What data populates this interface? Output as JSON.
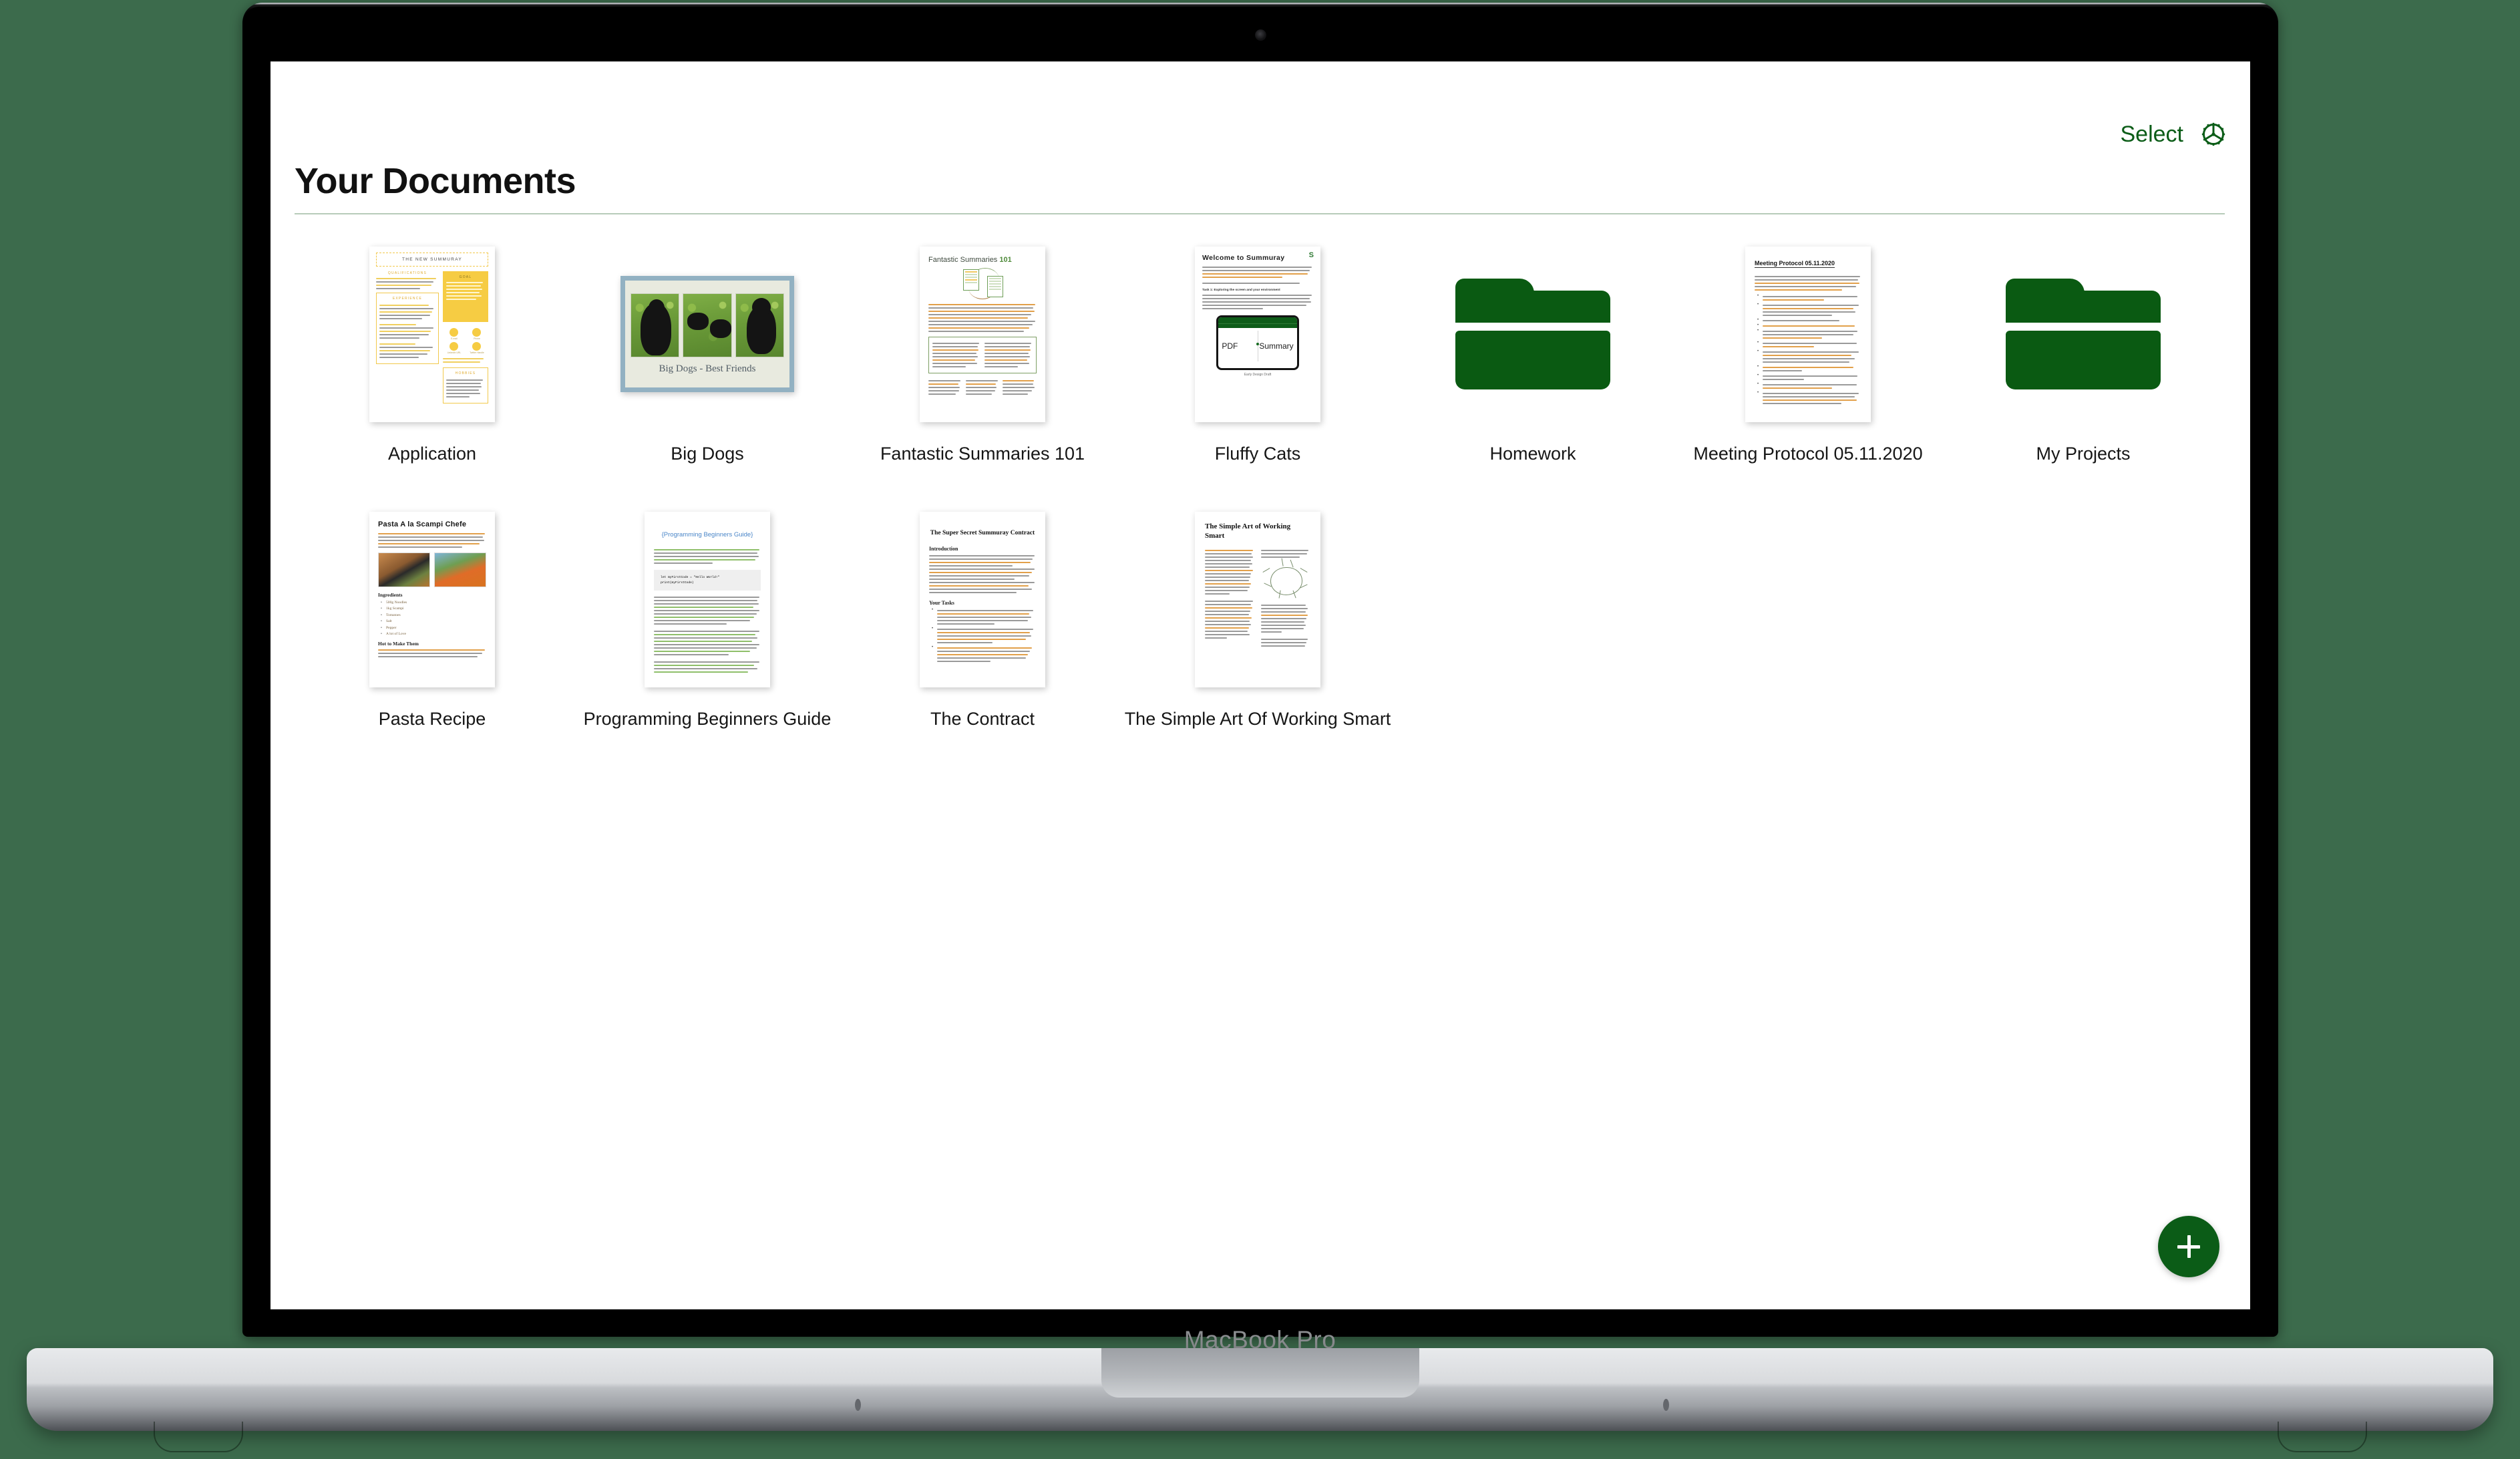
{
  "device": {
    "model_label": "MacBook Pro",
    "camera_icon": "camera-dot"
  },
  "app": {
    "title": "Your Documents",
    "accent_color": "#0b5c17",
    "header": {
      "select_label": "Select",
      "settings_icon": "gear-icon"
    },
    "fab": {
      "icon": "plus-icon",
      "color": "#0b5c17"
    }
  },
  "grid": {
    "items": [
      {
        "label": "Application",
        "type": "document",
        "thumbnail": {
          "kind": "cv",
          "title": "THE NEW SUMMURAY",
          "sections": [
            "QUALIFICATIONS",
            "EXPERIENCE",
            "GOAL",
            "HOBBIES"
          ],
          "accent": "#f6cc43",
          "contacts": [
            "E-mail",
            "Phone",
            "LinkedIn URL",
            "Twitter Handle"
          ]
        }
      },
      {
        "label": "Big Dogs",
        "type": "document",
        "selected": true,
        "thumbnail": {
          "kind": "photo-collage",
          "caption": "Big Dogs - Best Friends",
          "photo_count": 3,
          "selection_color": "#92b1c2",
          "page_color": "#e8eadf"
        }
      },
      {
        "label": "Fantastic Summaries 101",
        "type": "document",
        "thumbnail": {
          "kind": "article",
          "title_plain": "Fantastic Summaries ",
          "title_accent": "101",
          "accent": "#4f8a3a"
        }
      },
      {
        "label": "Fluffy Cats",
        "type": "document",
        "thumbnail": {
          "kind": "welcome",
          "title": "Welcome to Summuray",
          "task_heading": "Task 1: Exploring the screen and your environment",
          "tablet_left": "PDF",
          "tablet_right": "Summary",
          "figure_caption": "Early Design Draft",
          "logo": "S"
        }
      },
      {
        "label": "Homework",
        "type": "folder",
        "thumbnail": {
          "kind": "folder",
          "color": "#0a5a12"
        }
      },
      {
        "label": "Meeting Protocol 05.11.2020",
        "type": "document",
        "thumbnail": {
          "kind": "minutes",
          "title": "Meeting Protocol 05.11.2020",
          "highlight": "#d98b3a"
        }
      },
      {
        "label": "My Projects",
        "type": "folder",
        "thumbnail": {
          "kind": "folder",
          "color": "#0a5a12"
        }
      },
      {
        "label": "Pasta Recipe",
        "type": "document",
        "thumbnail": {
          "kind": "recipe",
          "title": "Pasta A la Scampi Chefe",
          "heading_1": "Ingredients",
          "heading_2": "Hot to Make Them",
          "ingredients": [
            "500g Noodles",
            "1kg Scampi",
            "Tomatoes",
            "Salt",
            "Pepper",
            "A lot of Love"
          ]
        }
      },
      {
        "label": "Programming Beginners Guide",
        "type": "document",
        "thumbnail": {
          "kind": "code-guide",
          "title": "{Programming Beginners Guide}",
          "title_color": "#4a86c8",
          "code_line_1": "let myFirstCode = \"Hello World!\"",
          "code_line_2": "print(myFirstCode)"
        }
      },
      {
        "label": "The Contract",
        "type": "document",
        "thumbnail": {
          "kind": "contract",
          "title": "The Super Secret Summuray Contract",
          "heading_1": "Introduction",
          "heading_2": "Your Tasks"
        }
      },
      {
        "label": "The Simple Art Of Working Smart",
        "type": "document",
        "thumbnail": {
          "kind": "two-column",
          "title": "The Simple Art of Working Smart",
          "figure": "brain-diagram"
        }
      }
    ]
  }
}
